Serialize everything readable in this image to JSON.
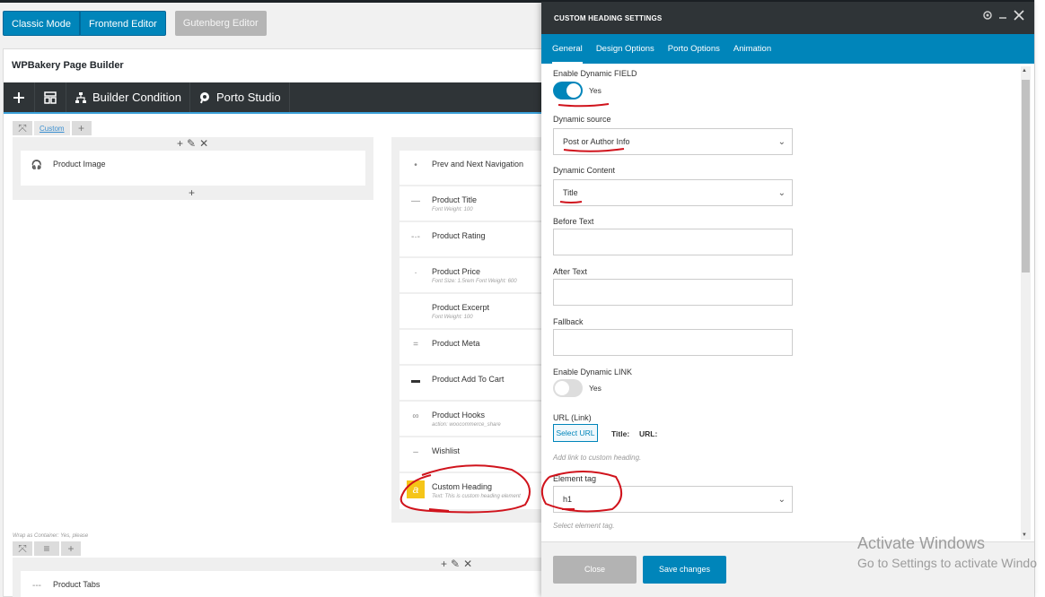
{
  "editor_modes": {
    "classic": "Classic Mode",
    "frontend": "Frontend Editor",
    "gutenberg": "Gutenberg Editor"
  },
  "builder": {
    "title": "WPBakery Page Builder",
    "toolbar": {
      "builder_condition": "Builder Condition",
      "porto_studio": "Porto Studio"
    },
    "row_label": "Custom",
    "wrap_note": "Wrap as Container: Yes, please",
    "left_elements": [
      {
        "title": "Product Image",
        "sub": ""
      }
    ],
    "right_elements": [
      {
        "title": "Prev and Next Navigation",
        "sub": ""
      },
      {
        "title": "Product Title",
        "sub": "Font Weight: 100"
      },
      {
        "title": "Product Rating",
        "sub": ""
      },
      {
        "title": "Product Price",
        "sub": "Font Size: 1.5rem  Font Weight: 600"
      },
      {
        "title": "Product Excerpt",
        "sub": "Font Weight: 100"
      },
      {
        "title": "Product Meta",
        "sub": ""
      },
      {
        "title": "Product Add To Cart",
        "sub": ""
      },
      {
        "title": "Product Hooks",
        "sub": "action: woocommerce_share"
      },
      {
        "title": "Wishlist",
        "sub": ""
      },
      {
        "title": "Custom Heading",
        "sub": "Text: This is custom heading element"
      }
    ],
    "bottom_elements": [
      {
        "title": "Product Tabs",
        "sub": ""
      }
    ]
  },
  "panel": {
    "title": "CUSTOM HEADING SETTINGS",
    "tabs": [
      "General",
      "Design Options",
      "Porto Options",
      "Animation"
    ],
    "fields": {
      "enable_dynamic_field": {
        "label": "Enable Dynamic FIELD",
        "state": "Yes",
        "on": true
      },
      "dynamic_source": {
        "label": "Dynamic source",
        "value": "Post or Author Info"
      },
      "dynamic_content": {
        "label": "Dynamic Content",
        "value": "Title"
      },
      "before_text": {
        "label": "Before Text",
        "value": ""
      },
      "after_text": {
        "label": "After Text",
        "value": ""
      },
      "fallback": {
        "label": "Fallback",
        "value": ""
      },
      "enable_dynamic_link": {
        "label": "Enable Dynamic LINK",
        "state": "Yes",
        "on": false
      },
      "url": {
        "label": "URL (Link)",
        "button": "Select URL",
        "title_label": "Title:",
        "url_label": "URL:",
        "help": "Add link to custom heading."
      },
      "element_tag": {
        "label": "Element tag",
        "value": "h1",
        "help": "Select element tag."
      }
    },
    "footer": {
      "close": "Close",
      "save": "Save changes"
    }
  },
  "watermark": {
    "line1": "Activate Windows",
    "line2": "Go to Settings to activate Windo"
  },
  "colors": {
    "accent": "#0085ba",
    "dark_bar": "#2f3437",
    "annotation": "#d0131c",
    "custom_heading_icon": "#f5c518"
  }
}
